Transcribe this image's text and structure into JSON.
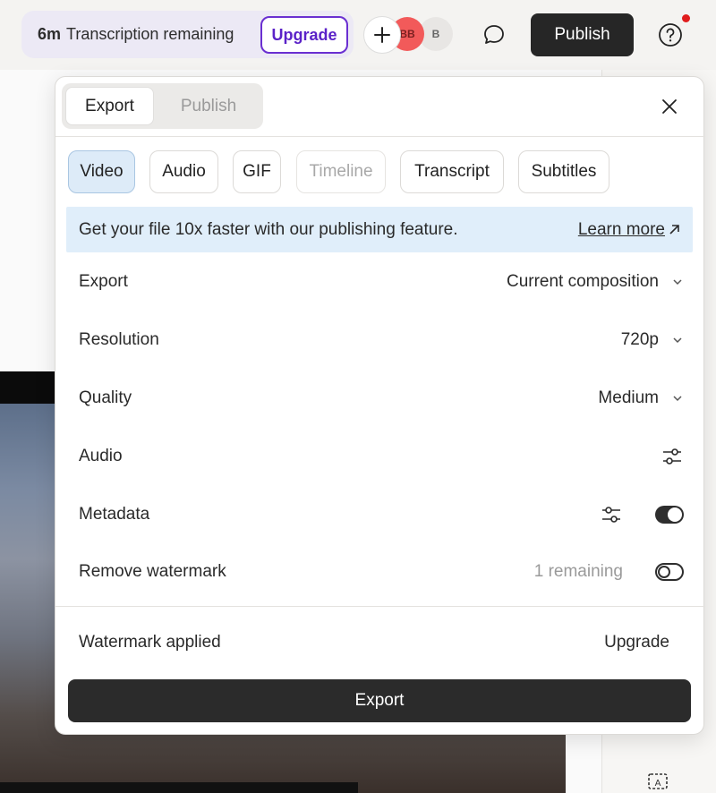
{
  "topbar": {
    "transcription_minutes": "6m",
    "transcription_text": "Transcription remaining",
    "upgrade_label": "Upgrade",
    "avatars": [
      "BB",
      "B"
    ],
    "publish_label": "Publish"
  },
  "modal": {
    "mode_tabs": [
      "Export",
      "Publish"
    ],
    "format_tabs": [
      {
        "label": "Video",
        "state": "selected"
      },
      {
        "label": "Audio",
        "state": "normal"
      },
      {
        "label": "GIF",
        "state": "normal"
      },
      {
        "label": "Timeline",
        "state": "disabled"
      },
      {
        "label": "Transcript",
        "state": "normal"
      },
      {
        "label": "Subtitles",
        "state": "normal"
      }
    ],
    "banner": {
      "text": "Get your file 10x faster with our publishing feature.",
      "link": "Learn more"
    },
    "settings": {
      "export": {
        "label": "Export",
        "value": "Current composition"
      },
      "resolution": {
        "label": "Resolution",
        "value": "720p"
      },
      "quality": {
        "label": "Quality",
        "value": "Medium"
      },
      "audio": {
        "label": "Audio"
      },
      "metadata": {
        "label": "Metadata",
        "enabled": true
      },
      "remove_watermark": {
        "label": "Remove watermark",
        "remaining": "1 remaining",
        "enabled": false
      }
    },
    "watermark": {
      "label": "Watermark applied",
      "action": "Upgrade"
    },
    "export_button": "Export"
  },
  "colors": {
    "accent_purple": "#5b22c8",
    "dark_button": "#262626",
    "selected_tab": "#ddebf8",
    "banner_bg": "#e0eefa",
    "notification": "#e01d1d"
  }
}
